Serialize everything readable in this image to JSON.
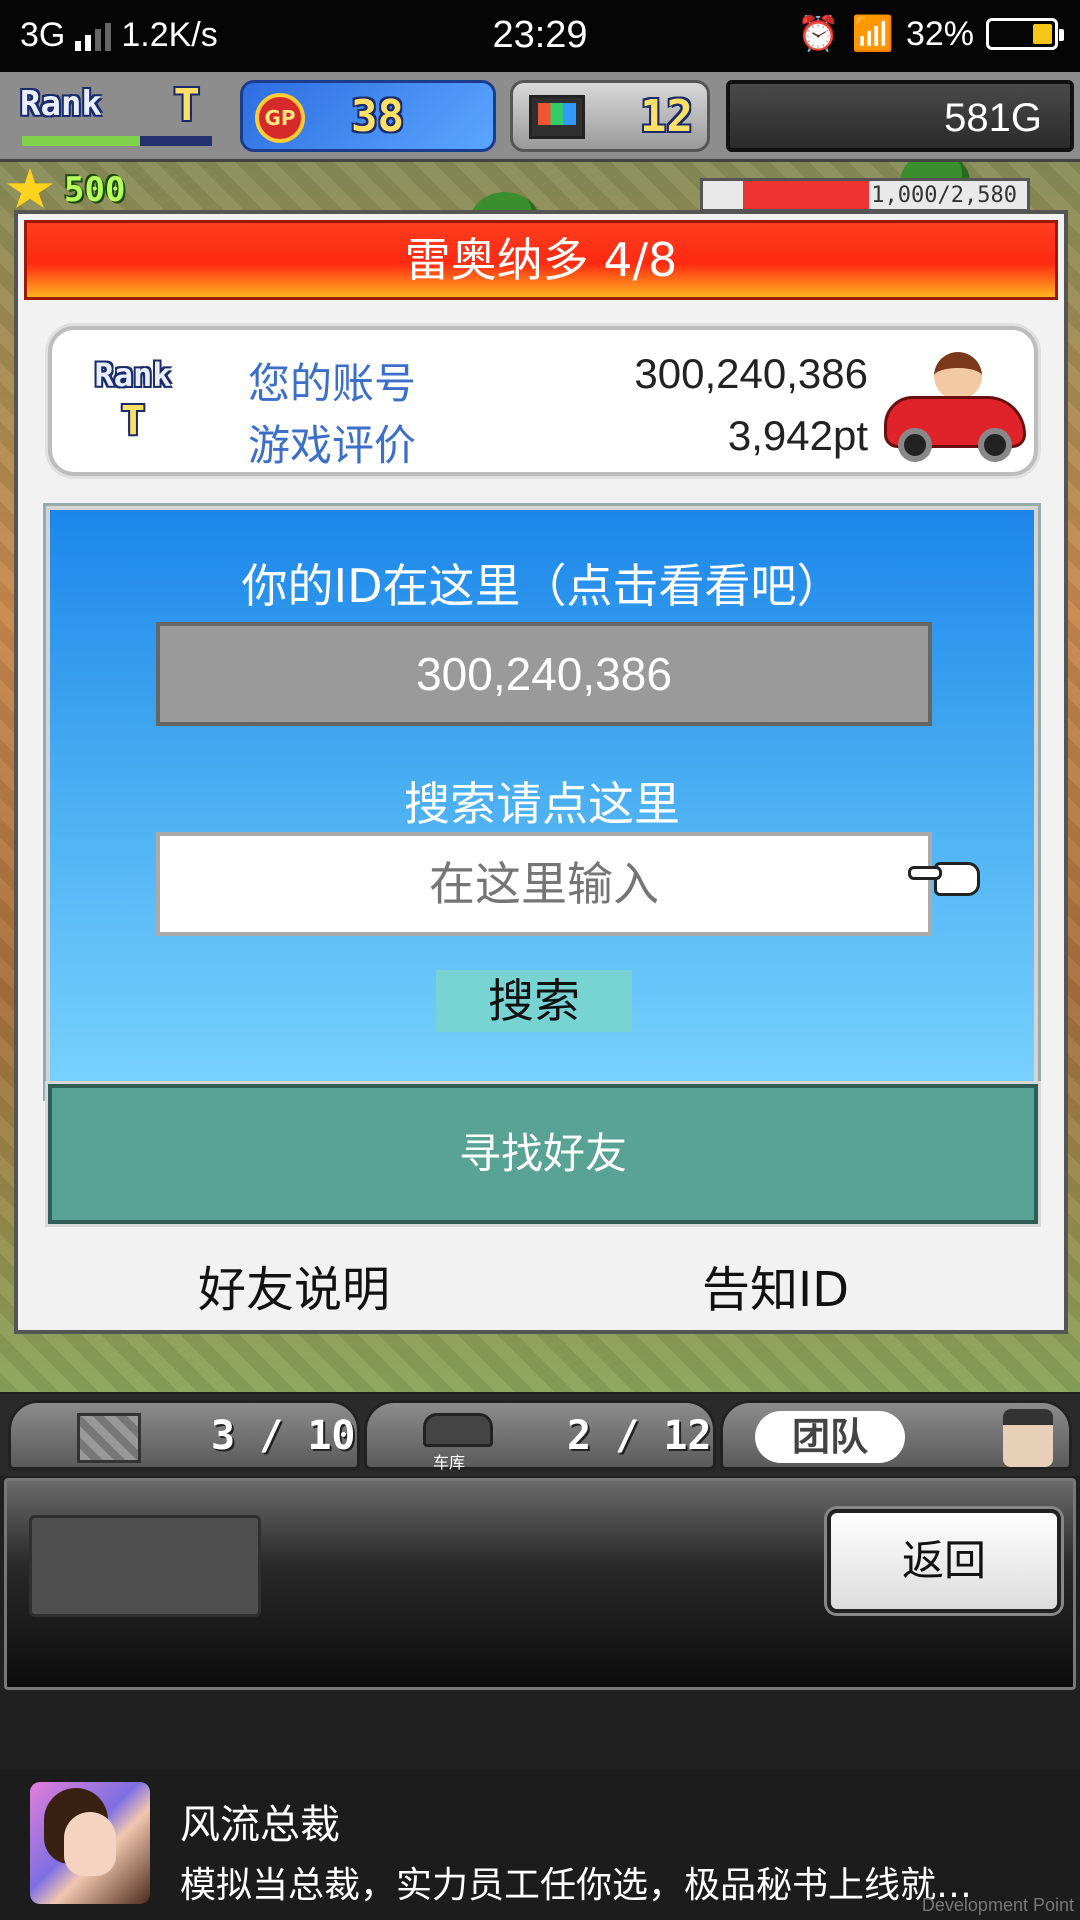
{
  "status_bar": {
    "network": "3G",
    "speed": "1.2K/s",
    "time": "23:29",
    "battery": "32%",
    "battery_level": 0.32,
    "battery_color": "#f5c518"
  },
  "hud": {
    "rank_word": "Rank",
    "rank_value": "T",
    "rank_progress": 0.62,
    "gp_label": "GP",
    "gp_value": "38",
    "pc_value": "12",
    "money": "581G",
    "stars": "500",
    "building_progress": "1,000/2,580",
    "building_fill": 0.39
  },
  "modal": {
    "title": "雷奥纳多 4/8",
    "title_color": "#ff2a12",
    "info": {
      "rank_word": "Rank",
      "rank_value": "T",
      "account_label": "您的账号",
      "account_value": "300,240,386",
      "rating_label": "游戏评价",
      "rating_value": "3,942pt"
    },
    "id_section": {
      "title": "你的ID在这里（点击看看吧）",
      "id_value": "300,240,386",
      "search_label": "搜索请点这里",
      "search_placeholder": "在这里输入",
      "search_button": "搜索"
    },
    "find_friends": "寻找好友",
    "friend_help": "好友说明",
    "notify_id": "告知ID"
  },
  "bottom": {
    "storage_count": "3 / 10",
    "garage_label": "车库",
    "garage_count": "2 / 12",
    "team_label": "团队",
    "back_button": "返回"
  },
  "ad": {
    "title": "风流总裁",
    "description": "模拟当总裁，实力员工任你选，极品秘书上线就…",
    "watermark": "Development Point"
  }
}
